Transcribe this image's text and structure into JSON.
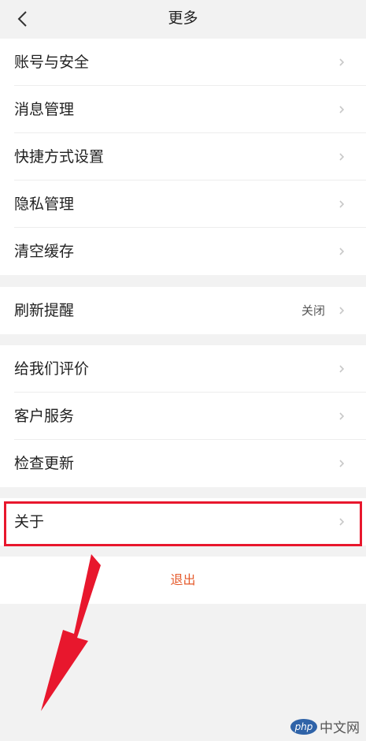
{
  "header": {
    "title": "更多"
  },
  "groups": [
    {
      "items": [
        {
          "label": "账号与安全"
        },
        {
          "label": "消息管理"
        },
        {
          "label": "快捷方式设置"
        },
        {
          "label": "隐私管理"
        },
        {
          "label": "清空缓存"
        }
      ]
    },
    {
      "items": [
        {
          "label": "刷新提醒",
          "value": "关闭"
        }
      ]
    },
    {
      "items": [
        {
          "label": "给我们评价"
        },
        {
          "label": "客户服务"
        },
        {
          "label": "检查更新"
        }
      ]
    },
    {
      "items": [
        {
          "label": "关于"
        }
      ]
    }
  ],
  "logout": {
    "label": "退出"
  },
  "annotation": {
    "highlight_color": "#e8172d"
  },
  "colors": {
    "background": "#f2f2f2",
    "logout_text": "#e55a2b"
  },
  "watermark": {
    "logo_text": "php",
    "text": "中文网"
  }
}
